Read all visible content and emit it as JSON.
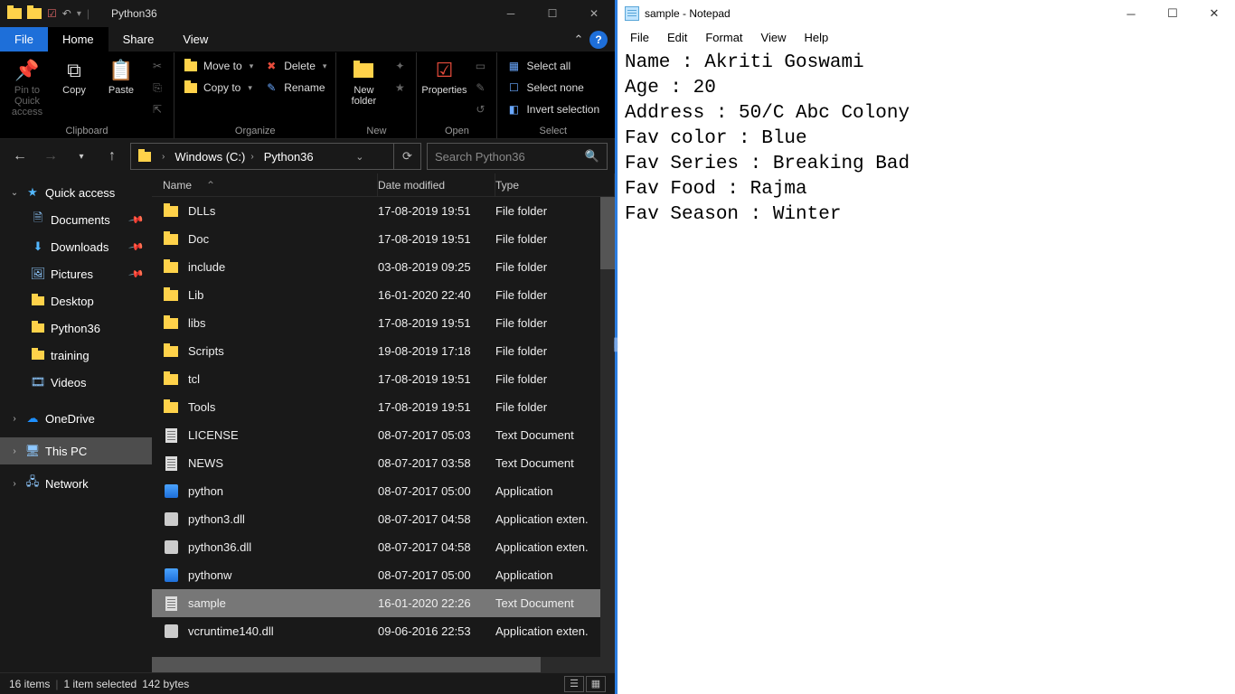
{
  "explorer": {
    "title": "Python36",
    "tabs": {
      "file": "File",
      "home": "Home",
      "share": "Share",
      "view": "View"
    },
    "ribbon": {
      "clipboard": {
        "label": "Clipboard",
        "pin": "Pin to Quick access",
        "copy": "Copy",
        "paste": "Paste",
        "cut": "Cut",
        "copypath": "Copy path",
        "pasteshort": "Paste shortcut"
      },
      "organize": {
        "label": "Organize",
        "moveto": "Move to",
        "copyto": "Copy to",
        "delete": "Delete",
        "rename": "Rename"
      },
      "new": {
        "label": "New",
        "newfolder": "New folder",
        "newitem": "New item",
        "easyaccess": "Easy access"
      },
      "open": {
        "label": "Open",
        "properties": "Properties",
        "open": "Open",
        "edit": "Edit",
        "history": "History"
      },
      "select": {
        "label": "Select",
        "all": "Select all",
        "none": "Select none",
        "invert": "Invert selection"
      }
    },
    "address": {
      "drive": "Windows (C:)",
      "folder": "Python36"
    },
    "search_placeholder": "Search Python36",
    "nav": {
      "quick": "Quick access",
      "documents": "Documents",
      "downloads": "Downloads",
      "pictures": "Pictures",
      "desktop": "Desktop",
      "python36": "Python36",
      "training": "training",
      "videos": "Videos",
      "onedrive": "OneDrive",
      "thispc": "This PC",
      "network": "Network"
    },
    "columns": {
      "name": "Name",
      "date": "Date modified",
      "type": "Type"
    },
    "files": [
      {
        "name": "DLLs",
        "date": "17-08-2019 19:51",
        "type": "File folder",
        "kind": "folder"
      },
      {
        "name": "Doc",
        "date": "17-08-2019 19:51",
        "type": "File folder",
        "kind": "folder"
      },
      {
        "name": "include",
        "date": "03-08-2019 09:25",
        "type": "File folder",
        "kind": "folder"
      },
      {
        "name": "Lib",
        "date": "16-01-2020 22:40",
        "type": "File folder",
        "kind": "folder"
      },
      {
        "name": "libs",
        "date": "17-08-2019 19:51",
        "type": "File folder",
        "kind": "folder"
      },
      {
        "name": "Scripts",
        "date": "19-08-2019 17:18",
        "type": "File folder",
        "kind": "folder"
      },
      {
        "name": "tcl",
        "date": "17-08-2019 19:51",
        "type": "File folder",
        "kind": "folder"
      },
      {
        "name": "Tools",
        "date": "17-08-2019 19:51",
        "type": "File folder",
        "kind": "folder"
      },
      {
        "name": "LICENSE",
        "date": "08-07-2017 05:03",
        "type": "Text Document",
        "kind": "doc"
      },
      {
        "name": "NEWS",
        "date": "08-07-2017 03:58",
        "type": "Text Document",
        "kind": "doc"
      },
      {
        "name": "python",
        "date": "08-07-2017 05:00",
        "type": "Application",
        "kind": "app"
      },
      {
        "name": "python3.dll",
        "date": "08-07-2017 04:58",
        "type": "Application exten.",
        "kind": "dll"
      },
      {
        "name": "python36.dll",
        "date": "08-07-2017 04:58",
        "type": "Application exten.",
        "kind": "dll"
      },
      {
        "name": "pythonw",
        "date": "08-07-2017 05:00",
        "type": "Application",
        "kind": "app"
      },
      {
        "name": "sample",
        "date": "16-01-2020 22:26",
        "type": "Text Document",
        "kind": "doc",
        "selected": true
      },
      {
        "name": "vcruntime140.dll",
        "date": "09-06-2016 22:53",
        "type": "Application exten.",
        "kind": "dll"
      }
    ],
    "status": {
      "count": "16 items",
      "sel": "1 item selected",
      "size": "142 bytes"
    }
  },
  "notepad": {
    "title": "sample - Notepad",
    "menus": {
      "file": "File",
      "edit": "Edit",
      "format": "Format",
      "view": "View",
      "help": "Help"
    },
    "content": "Name : Akriti Goswami\nAge : 20\nAddress : 50/C Abc Colony\nFav color : Blue\nFav Series : Breaking Bad\nFav Food : Rajma\nFav Season : Winter"
  }
}
